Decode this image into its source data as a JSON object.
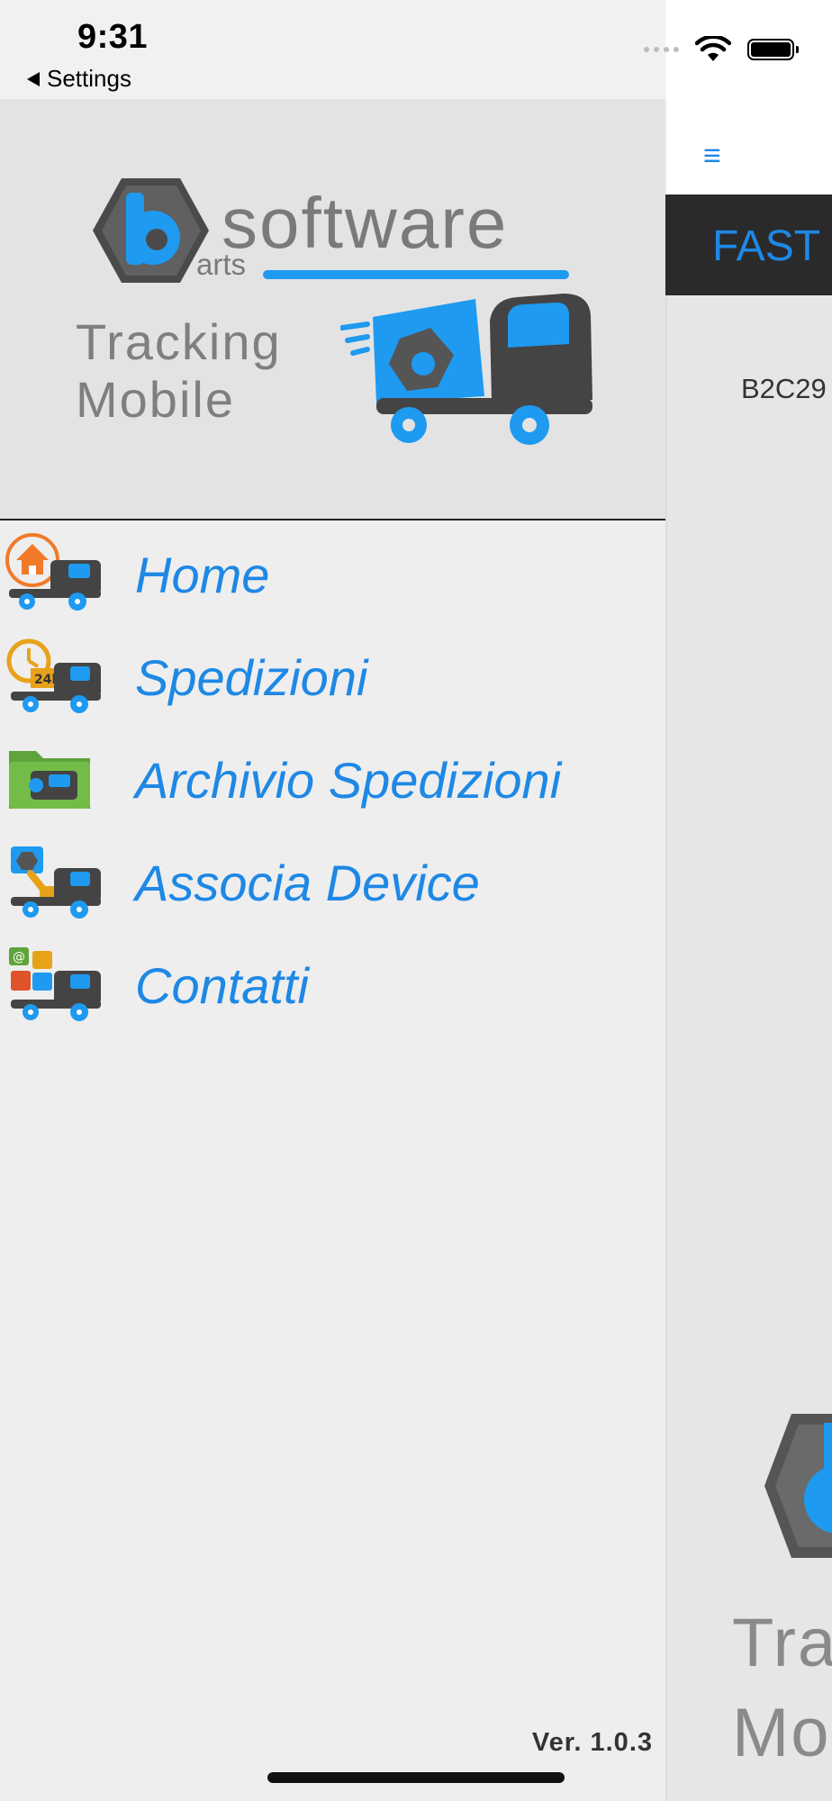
{
  "status_bar": {
    "time": "9:31",
    "back_label": "Settings"
  },
  "drawer": {
    "brand": {
      "name": "software",
      "sub": "arts",
      "tagline": "Tracking\nMobile"
    },
    "menu": [
      {
        "label": "Home",
        "icon": "home-truck-icon"
      },
      {
        "label": "Spedizioni",
        "icon": "clock-24h-truck-icon"
      },
      {
        "label": "Archivio Spedizioni",
        "icon": "folder-truck-icon"
      },
      {
        "label": "Associa Device",
        "icon": "plug-truck-icon"
      },
      {
        "label": "Contatti",
        "icon": "contacts-truck-icon"
      }
    ],
    "version": "Ver. 1.0.3"
  },
  "main": {
    "header_title": "FAST",
    "code": "B2C29",
    "logo_text": "Tra\nMo"
  },
  "colors": {
    "accent": "#1e88e5",
    "dark_bar": "#2a2a2a",
    "logo_gray": "#7a7a7a"
  }
}
